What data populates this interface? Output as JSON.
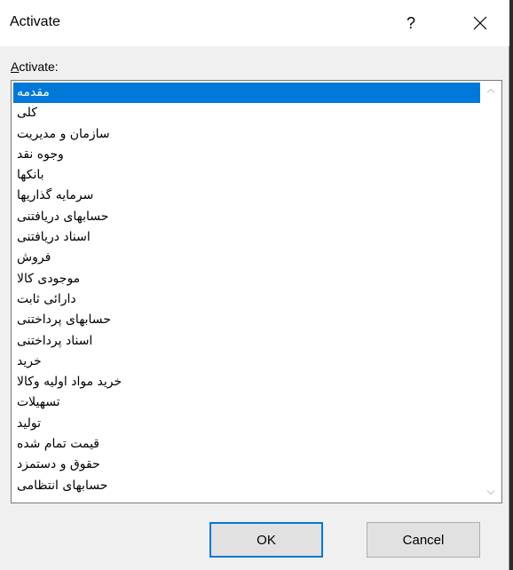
{
  "window": {
    "title": "Activate",
    "help_glyph": "?",
    "close_icon": "close-icon"
  },
  "list": {
    "label_access": "A",
    "label_rest": "ctivate:",
    "selected_index": 0,
    "items": [
      "مقدمه",
      "کلی",
      " سازمان و مدیریت",
      "وجوه نقد",
      "بانکها",
      "سرمایه گذاریها",
      "حسابهای دریافتنی",
      "اسناد دریافتنی",
      "فروش",
      "موجودی کالا",
      "دارائی ثابت",
      "حسابهای پرداختنی",
      "اسناد پرداختنی",
      "خرید",
      "خرید مواد اولیه وکالا",
      "تسهیلات",
      "تولید",
      "قیمت تمام شده",
      "حقوق و دستمزد",
      "حسابهای انتظامی"
    ]
  },
  "buttons": {
    "ok": "OK",
    "cancel": "Cancel"
  },
  "colors": {
    "selection": "#0078d7",
    "dialog_bg": "#f0f0f0",
    "titlebar_bg": "#ffffff"
  }
}
